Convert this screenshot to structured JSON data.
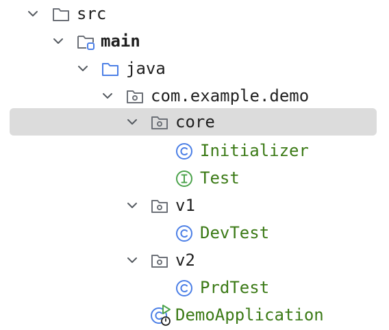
{
  "project_tree": {
    "nodes": [
      {
        "label": "src",
        "kind": "folder",
        "expanded": true,
        "selected": false
      },
      {
        "label": "main",
        "kind": "source-root",
        "expanded": true,
        "selected": false
      },
      {
        "label": "java",
        "kind": "folder-blue",
        "expanded": true,
        "selected": false
      },
      {
        "label": "com.example.demo",
        "kind": "package",
        "expanded": true,
        "selected": false
      },
      {
        "label": "core",
        "kind": "package",
        "expanded": true,
        "selected": true
      },
      {
        "label": "Initializer",
        "kind": "class",
        "expanded": null,
        "selected": false
      },
      {
        "label": "Test",
        "kind": "interface",
        "expanded": null,
        "selected": false
      },
      {
        "label": "v1",
        "kind": "package",
        "expanded": true,
        "selected": false
      },
      {
        "label": "DevTest",
        "kind": "class",
        "expanded": null,
        "selected": false
      },
      {
        "label": "v2",
        "kind": "package",
        "expanded": true,
        "selected": false
      },
      {
        "label": "PrdTest",
        "kind": "class",
        "expanded": null,
        "selected": false
      },
      {
        "label": "DemoApplication",
        "kind": "spring-boot-class",
        "expanded": null,
        "selected": false
      }
    ]
  },
  "colors": {
    "text": "#1f1f1f",
    "class_text": "#3b7a16",
    "selection": "#dcdcdc",
    "class_icon": "#4a7ee6",
    "interface_icon": "#4ca34c",
    "spring_icon": "#4ca34c",
    "folder_stroke": "#6b6f76",
    "blue_folder_stroke": "#4a7ee6"
  }
}
